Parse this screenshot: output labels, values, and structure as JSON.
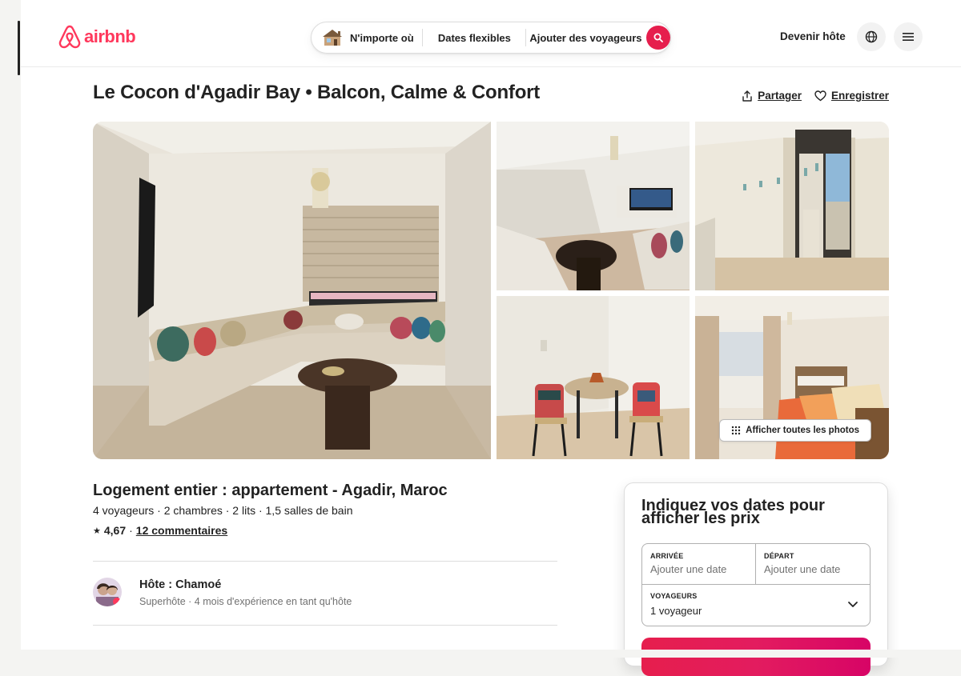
{
  "brand": {
    "name": "airbnb",
    "color": "#ff385c"
  },
  "search": {
    "anywhere": "N'importe où",
    "dates": "Dates flexibles",
    "guests": "Ajouter des voyageurs",
    "button_icon": "search-icon"
  },
  "header": {
    "host_link": "Devenir hôte",
    "globe_icon": "globe-icon",
    "menu_icon": "hamburger-icon"
  },
  "listing": {
    "title": "Le Cocon d'Agadir Bay • Balcon, Calme & Confort",
    "share_label": "Partager",
    "save_label": "Enregistrer",
    "show_all_photos": "Afficher toutes les photos",
    "type_title": "Logement entier : appartement - Agadir, Maroc",
    "summary": "4 voyageurs · 2 chambres · 2 lits · 1,5 salles de bain",
    "rating_star": "★",
    "rating": "4,67",
    "rating_sep": "·",
    "reviews": "12 commentaires"
  },
  "host": {
    "label": "Hôte : Chamoé",
    "meta": "Superhôte · 4 mois d'expérience en tant qu'hôte"
  },
  "booking": {
    "title": "Indiquez vos dates pour afficher les prix",
    "checkin_label": "ARRIVÉE",
    "checkin_placeholder": "Ajouter une date",
    "checkout_label": "DÉPART",
    "checkout_placeholder": "Ajouter une date",
    "guests_label": "VOYAGEURS",
    "guests_value": "1 voyageur",
    "button_color": "#e61e4d"
  }
}
